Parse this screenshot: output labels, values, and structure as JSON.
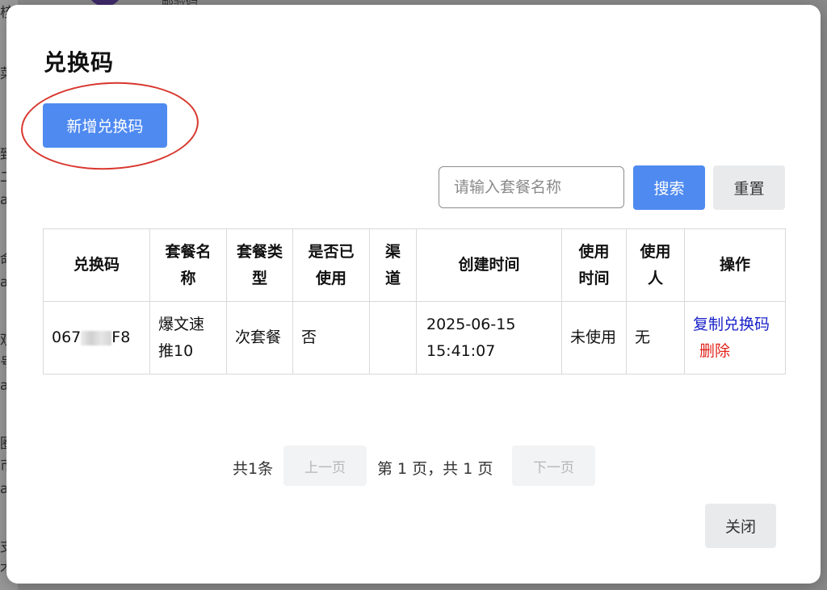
{
  "background": {
    "top_text": "邮验码",
    "side_chars": [
      "核",
      "菜",
      "致",
      "二",
      "a",
      "命",
      "a",
      "观",
      "号",
      "a",
      "圈",
      "币",
      "a",
      "支",
      "术"
    ]
  },
  "modal": {
    "title": "兑换码",
    "add_button": "新增兑换码",
    "search": {
      "placeholder": "请输入套餐名称",
      "value": "",
      "search_button": "搜索",
      "reset_button": "重置"
    },
    "table": {
      "headers": [
        "兑换码",
        "套餐名称",
        "套餐类型",
        "是否已使用",
        "渠道",
        "创建时间",
        "使用时间",
        "使用人",
        "操作"
      ],
      "rows": [
        {
          "code_prefix": "067",
          "code_suffix": "F8",
          "package_name": "爆文速推10",
          "package_type": "次套餐",
          "used": "否",
          "channel": "",
          "created_at": "2025-06-15 15:41:07",
          "used_at": "未使用",
          "user": "无",
          "action_copy": "复制兑换码",
          "action_delete": "删除"
        }
      ]
    },
    "pagination": {
      "total": "共1条",
      "prev": "上一页",
      "info": "第 1 页，共 1 页",
      "next": "下一页"
    },
    "close_button": "关闭"
  },
  "colors": {
    "primary": "#4f8af0",
    "link_blue": "#1a22c8",
    "danger_red": "#e0241b",
    "annotation_red": "#d8362d"
  }
}
